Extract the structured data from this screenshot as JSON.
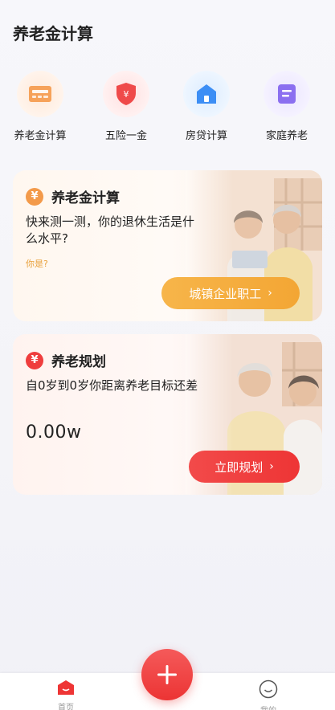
{
  "page": {
    "title": "养老金计算"
  },
  "quick_nav": {
    "items": [
      {
        "label": "养老金计算",
        "icon": "pension-calculator-icon",
        "color": "#f39a4a"
      },
      {
        "label": "五险一金",
        "icon": "insurance-shield-icon",
        "color": "#ef3d3d"
      },
      {
        "label": "房贷计算",
        "icon": "house-icon",
        "color": "#3c8ef5"
      },
      {
        "label": "家庭养老",
        "icon": "family-document-icon",
        "color": "#8b6ff0"
      }
    ]
  },
  "pension_card": {
    "badge": "¥",
    "title": "养老金计算",
    "desc": "快来测一测，你的退休生活是什么水平?",
    "question": "你是?",
    "button_label": "城镇企业职工",
    "button_chevron": "›"
  },
  "plan_card": {
    "badge": "¥",
    "title": "养老规划",
    "desc": "自0岁到0岁你距离养老目标还差",
    "amount": "0.00w",
    "button_label": "立即规划",
    "button_chevron": "›"
  },
  "tabbar": {
    "home_label": "首页",
    "me_label": "我的",
    "accent": "#ee3535"
  }
}
